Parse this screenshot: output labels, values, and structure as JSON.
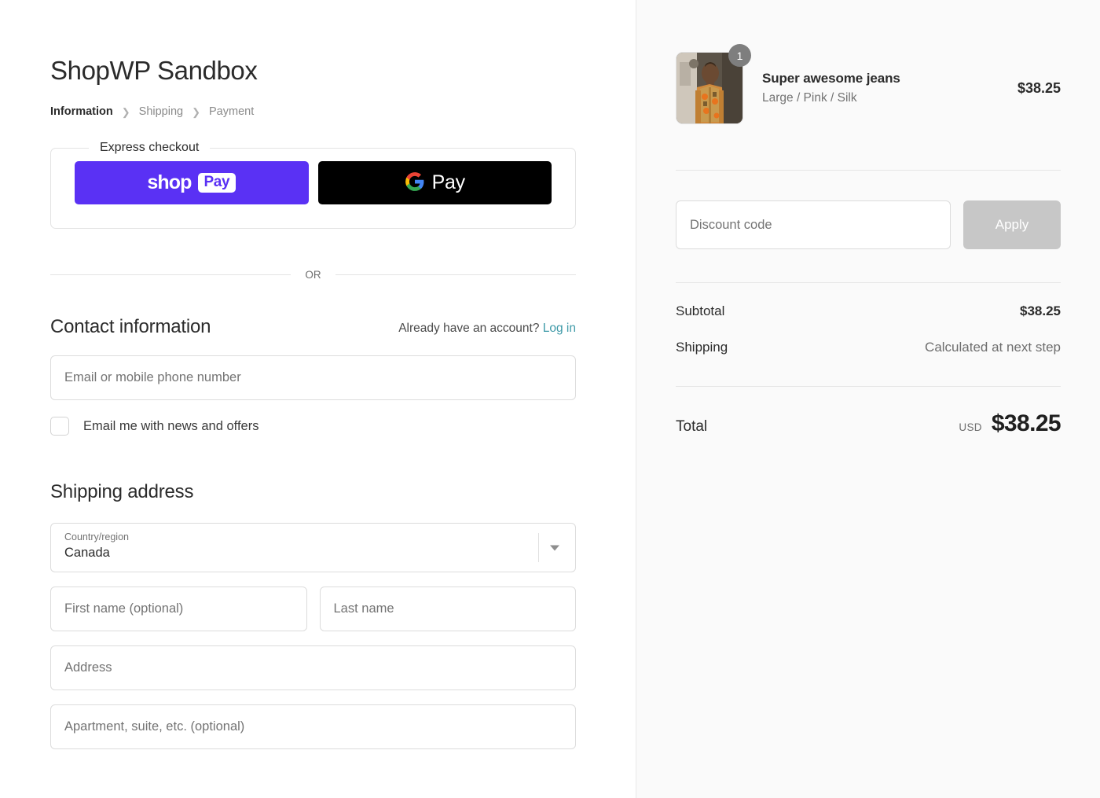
{
  "store": {
    "title": "ShopWP Sandbox"
  },
  "breadcrumb": {
    "items": [
      {
        "label": "Information",
        "current": true
      },
      {
        "label": "Shipping",
        "current": false
      },
      {
        "label": "Payment",
        "current": false
      }
    ],
    "separator": "❯"
  },
  "express": {
    "legend": "Express checkout",
    "shop_pay": {
      "word": "shop",
      "badge": "Pay"
    },
    "google_pay": {
      "text": "Pay"
    }
  },
  "divider": {
    "or_text": "OR"
  },
  "contact": {
    "title": "Contact information",
    "account_prompt": "Already have an account?",
    "login_link": "Log in",
    "email_placeholder": "Email or mobile phone number",
    "email_value": "",
    "newsletter_label": "Email me with news and offers",
    "newsletter_checked": false
  },
  "shipping_address": {
    "title": "Shipping address",
    "country": {
      "label": "Country/region",
      "value": "Canada"
    },
    "first_name_placeholder": "First name (optional)",
    "first_name_value": "",
    "last_name_placeholder": "Last name",
    "last_name_value": "",
    "address_placeholder": "Address",
    "address_value": "",
    "apartment_placeholder": "Apartment, suite, etc. (optional)",
    "apartment_value": ""
  },
  "order_summary": {
    "line_items": [
      {
        "title": "Super awesome jeans",
        "variant": "Large / Pink / Silk",
        "price": "$38.25",
        "quantity": "1"
      }
    ],
    "discount": {
      "placeholder": "Discount code",
      "value": "",
      "apply_label": "Apply"
    },
    "subtotal_label": "Subtotal",
    "subtotal_value": "$38.25",
    "shipping_label": "Shipping",
    "shipping_value": "Calculated at next step",
    "total_label": "Total",
    "total_currency": "USD",
    "total_value": "$38.25"
  },
  "colors": {
    "shop_pay_purple": "#5a31f4",
    "google_pay_black": "#000000",
    "link_teal": "#3f9aa8",
    "sidebar_bg": "#fafafa",
    "apply_disabled": "#c7c7c7"
  }
}
